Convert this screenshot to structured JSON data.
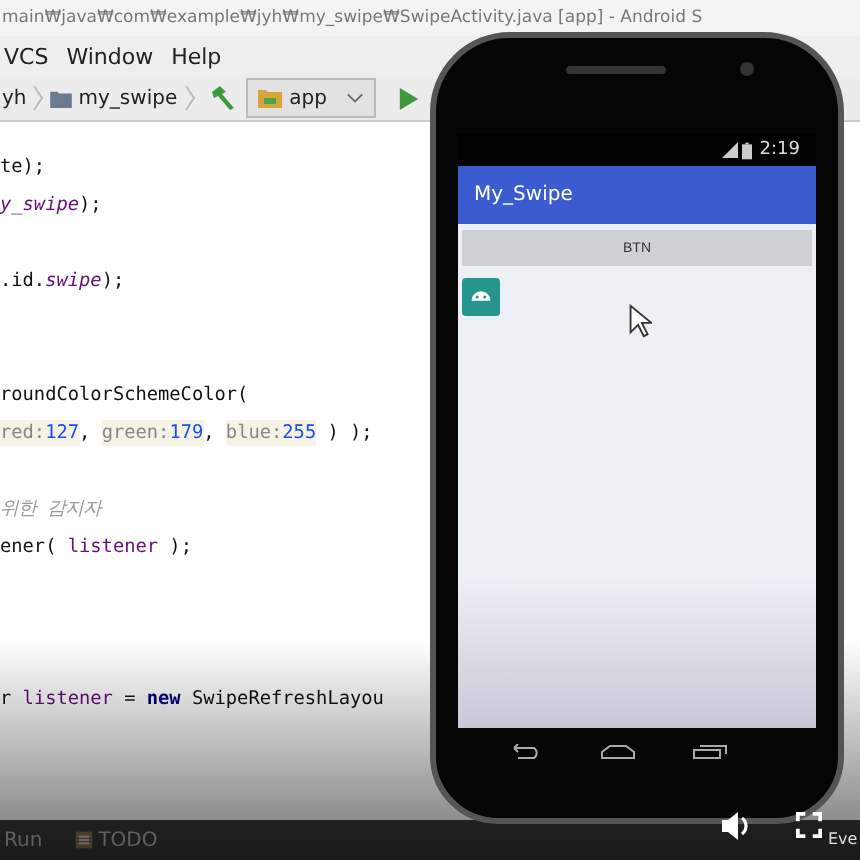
{
  "window": {
    "title": "main₩java₩com₩example₩jyh₩my_swipe₩SwipeActivity.java [app] - Android S"
  },
  "menu": [
    {
      "label": "VCS"
    },
    {
      "label": "Window"
    },
    {
      "label": "Help"
    }
  ],
  "breadcrumb": [
    {
      "label": "yh",
      "kind": "text"
    },
    {
      "label": "my_swipe",
      "kind": "folder"
    }
  ],
  "run_config": {
    "label": "app"
  },
  "code_lines": [
    {
      "kind": "code",
      "segments": [
        {
          "kind": "plain",
          "text": "te);"
        }
      ]
    },
    {
      "kind": "code",
      "segments": [
        {
          "kind": "field",
          "text": "y_swipe"
        },
        {
          "kind": "plain",
          "text": ");"
        }
      ]
    },
    {
      "kind": "blank"
    },
    {
      "kind": "code",
      "segments": [
        {
          "kind": "plain",
          "text": ".id."
        },
        {
          "kind": "field",
          "text": "swipe"
        },
        {
          "kind": "plain",
          "text": ");"
        }
      ]
    },
    {
      "kind": "blank"
    },
    {
      "kind": "blank"
    },
    {
      "kind": "code",
      "segments": [
        {
          "kind": "plain",
          "text": "roundColorSchemeColor("
        }
      ]
    },
    {
      "kind": "code",
      "segments": [
        {
          "kind": "hint",
          "text": "red:"
        },
        {
          "kind": "num",
          "text": "127"
        },
        {
          "kind": "plain",
          "text": ", "
        },
        {
          "kind": "hint",
          "text": "green:"
        },
        {
          "kind": "num",
          "text": "179"
        },
        {
          "kind": "plain",
          "text": ", "
        },
        {
          "kind": "hint",
          "text": "blue:"
        },
        {
          "kind": "num",
          "text": "255"
        },
        {
          "kind": "plain",
          "text": " ) );"
        }
      ]
    },
    {
      "kind": "blank"
    },
    {
      "kind": "code",
      "segments": [
        {
          "kind": "comment",
          "text": "위한 감지자"
        }
      ]
    },
    {
      "kind": "code",
      "segments": [
        {
          "kind": "plain",
          "text": "ener( "
        },
        {
          "kind": "var",
          "text": "listener"
        },
        {
          "kind": "plain",
          "text": " );"
        }
      ]
    },
    {
      "kind": "blank"
    },
    {
      "kind": "blank"
    },
    {
      "kind": "blank"
    },
    {
      "kind": "code",
      "segments": [
        {
          "kind": "plain",
          "text": "r "
        },
        {
          "kind": "var",
          "text": "listener"
        },
        {
          "kind": "plain",
          "text": " = "
        },
        {
          "kind": "kw",
          "text": "new"
        },
        {
          "kind": "plain",
          "text": " SwipeRefreshLayou"
        }
      ]
    }
  ],
  "bottom_tabs": [
    {
      "label": "Run",
      "kind": "run"
    },
    {
      "label": "TODO",
      "kind": "todo"
    }
  ],
  "edge_text": "Eve",
  "emulator": {
    "time": "2:19",
    "app_title": "My_Swipe",
    "button": "BTN"
  }
}
